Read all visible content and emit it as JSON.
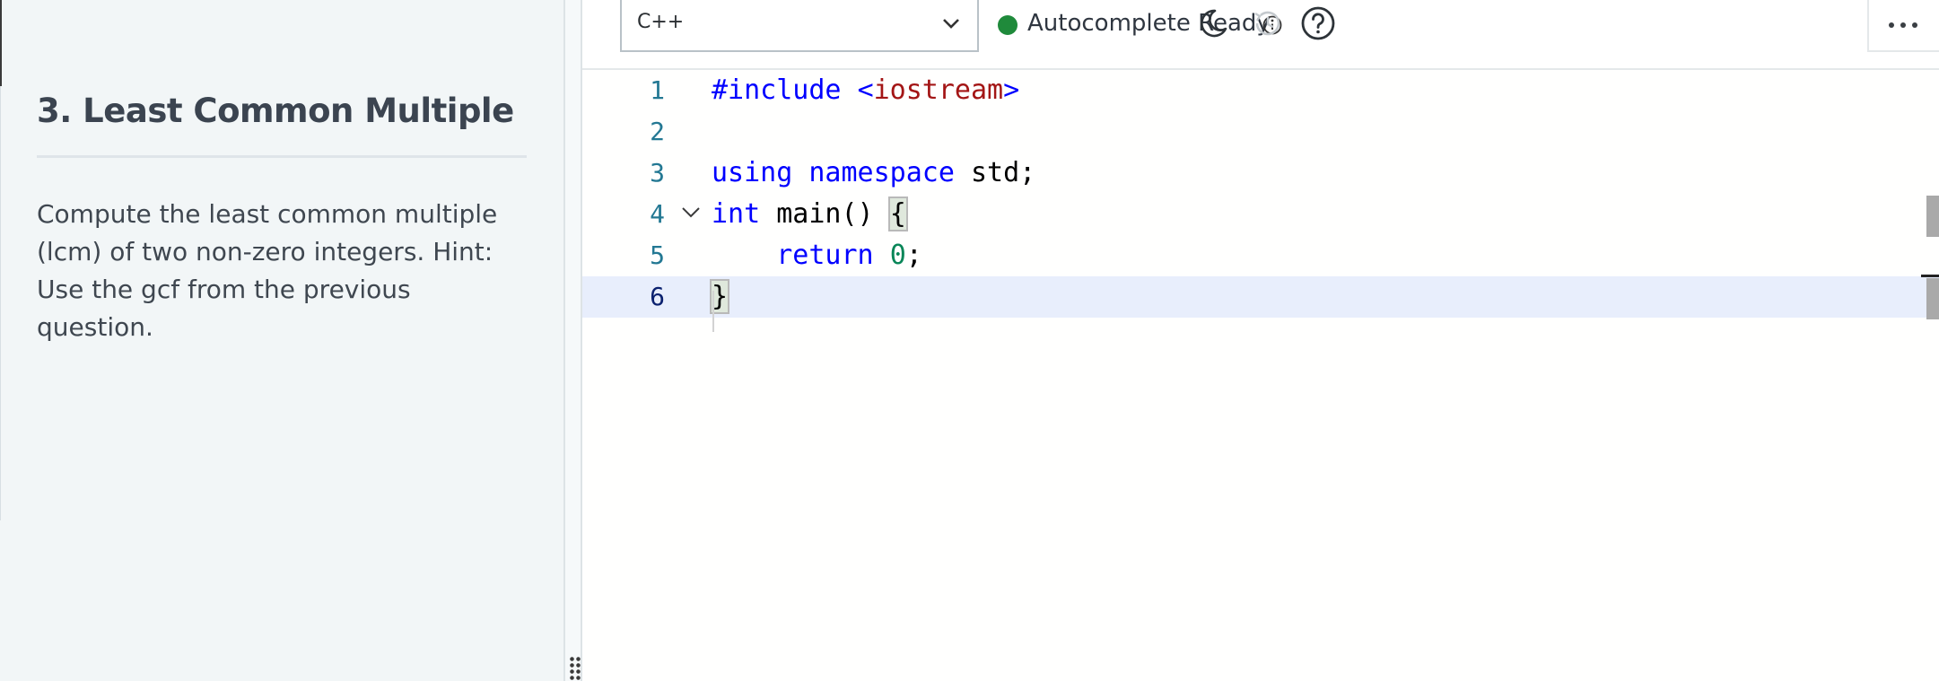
{
  "problem": {
    "title": "3. Least Common Multiple",
    "description": "Compute the least common multiple (lcm) of two non-zero integers. Hint: Use the gcf from the previous question."
  },
  "toolbar": {
    "language": "C++",
    "status": "Autocomplete Ready",
    "status_color": "#1f8a3b",
    "icons": [
      "moon-icon",
      "history-icon",
      "help-icon",
      "more-icon"
    ]
  },
  "editor": {
    "lines": [
      {
        "number": "1",
        "segments": [
          [
            "kw",
            "#include "
          ],
          [
            "kw",
            "<"
          ],
          [
            "inc",
            "iostream"
          ],
          [
            "kw",
            ">"
          ]
        ]
      },
      {
        "number": "2",
        "segments": []
      },
      {
        "number": "3",
        "segments": [
          [
            "kw",
            "using"
          ],
          [
            "",
            " "
          ],
          [
            "kw",
            "namespace"
          ],
          [
            "",
            " std;"
          ]
        ]
      },
      {
        "number": "4",
        "segments": [
          [
            "kw",
            "int"
          ],
          [
            "",
            " main() "
          ],
          [
            "brace",
            "{"
          ]
        ],
        "foldable": true
      },
      {
        "number": "5",
        "segments": [
          [
            "",
            "    "
          ],
          [
            "kw",
            "return"
          ],
          [
            "",
            " "
          ],
          [
            "num",
            "0"
          ],
          [
            "",
            ";"
          ]
        ]
      },
      {
        "number": "6",
        "segments": [
          [
            "brace",
            "}"
          ]
        ],
        "current": true
      }
    ]
  }
}
